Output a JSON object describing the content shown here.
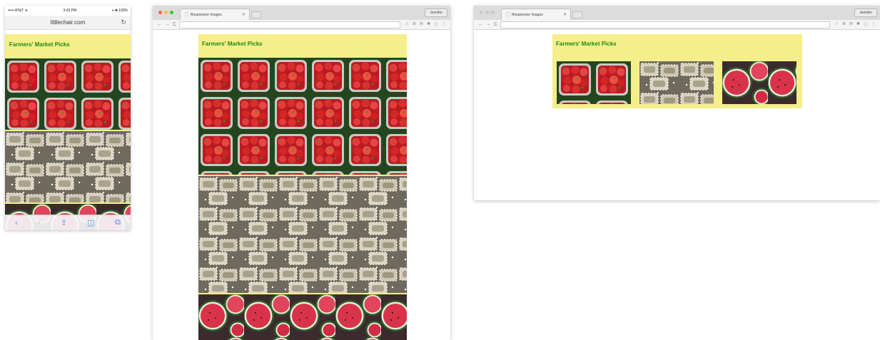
{
  "site": {
    "title": "Farmers' Market Picks",
    "photos": [
      {
        "name": "strawberries-photo",
        "subject": "strawberries"
      },
      {
        "name": "ravioli-photo",
        "subject": "ravioli"
      },
      {
        "name": "watermelon-photo",
        "subject": "watermelon"
      }
    ],
    "colors": {
      "background": "#f4ef8a",
      "title": "#1e8a12"
    }
  },
  "phone": {
    "status_left": "••••• AT&T ≋",
    "status_time": "3:43 PM",
    "status_right": "⌖ ✱ 100%",
    "url": "littlechair.com",
    "toolbar_icons": [
      "back-icon",
      "forward-icon",
      "share-icon",
      "bookmarks-icon",
      "tabs-icon"
    ]
  },
  "browser": {
    "tab_title": "Responsive Images",
    "user_button": "Jennifer",
    "traffic_lights": [
      "#ff5f57",
      "#febc2e",
      "#28c840"
    ],
    "inactive_light": "#c9c9c9"
  }
}
